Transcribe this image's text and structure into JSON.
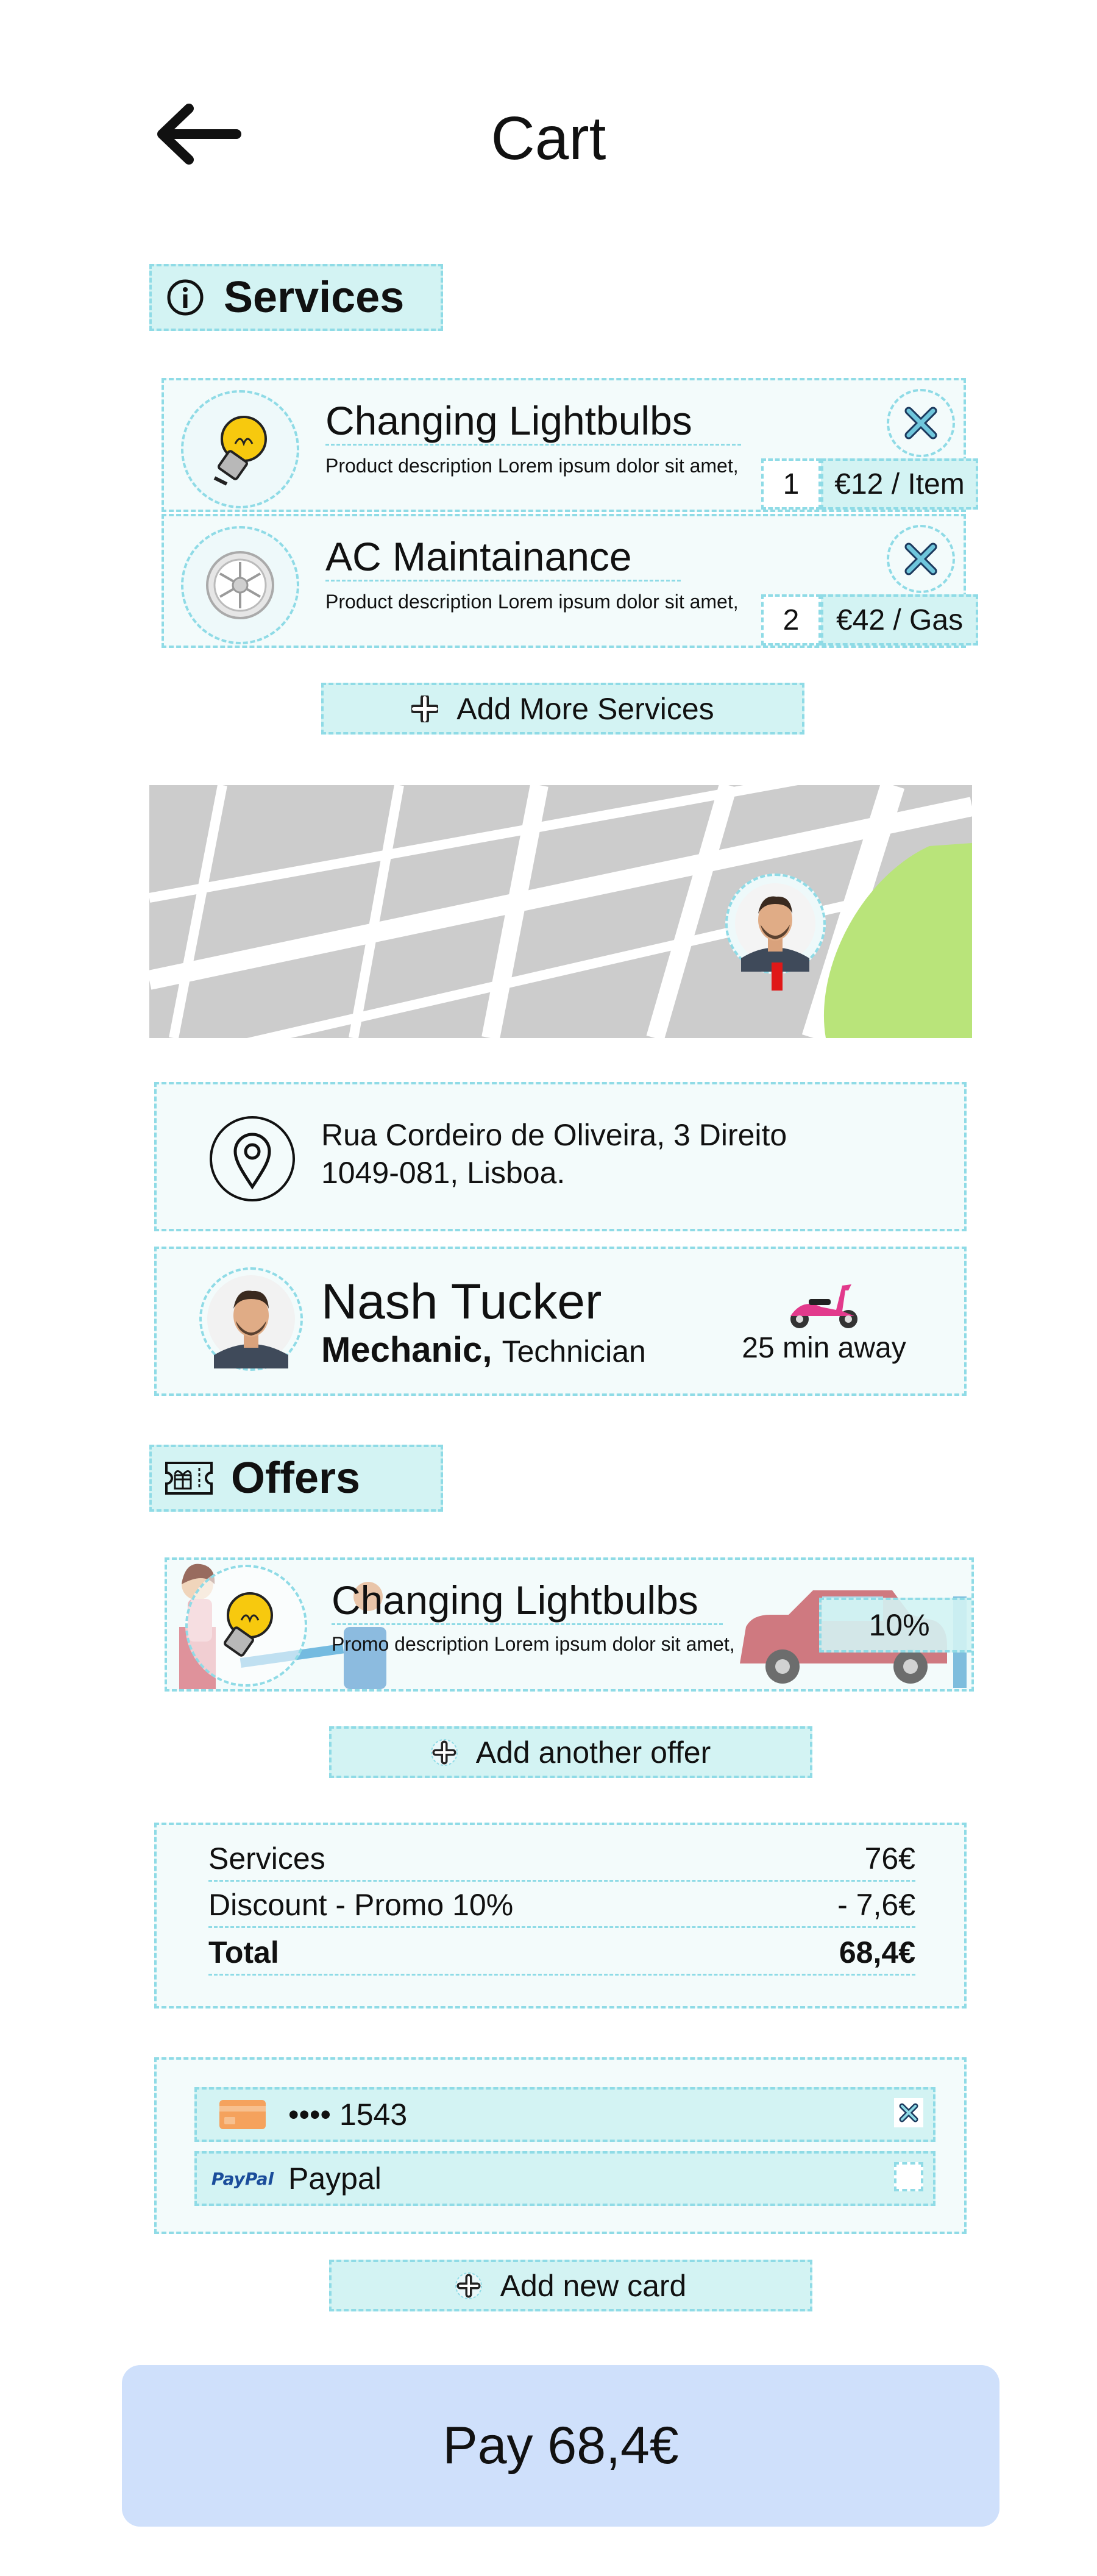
{
  "header": {
    "title": "Cart",
    "back_icon": "arrow-left-icon"
  },
  "services_section": {
    "title": "Services",
    "icon": "info-icon",
    "items": [
      {
        "name": "Changing Lightbulbs",
        "description": "Product description Lorem ipsum dolor sit amet,",
        "quantity": "1",
        "price": "€12 / Item",
        "icon": "lightbulb-icon"
      },
      {
        "name": "AC Maintainance",
        "description": "Product description Lorem ipsum dolor sit amet,",
        "quantity": "2",
        "price": "€42 / Gas",
        "icon": "ac-fan-icon"
      }
    ],
    "add_label": "Add More Services"
  },
  "address": {
    "line1": "Rua Cordeiro de Oliveira, 3 Direito",
    "line2": "1049-081, Lisboa.",
    "icon": "location-pin-icon"
  },
  "worker": {
    "name": "Nash Tucker",
    "role": "Mechanic,",
    "subrole": "Technician",
    "eta": "25 min away",
    "vehicle_icon": "scooter-icon"
  },
  "offers_section": {
    "title": "Offers",
    "icon": "gift-voucher-icon",
    "offer": {
      "name": "Changing Lightbulbs",
      "description": "Promo description Lorem ipsum dolor sit amet,",
      "discount": "10%"
    },
    "add_label": "Add another offer"
  },
  "summary": {
    "rows": [
      {
        "label": "Services",
        "value": "76€"
      },
      {
        "label": "Discount - Promo 10%",
        "value": "- 7,6€"
      }
    ],
    "total_label": "Total",
    "total_value": "68,4€"
  },
  "payments": {
    "methods": [
      {
        "label": "•••• 1543",
        "icon": "credit-card-icon",
        "selected": true
      },
      {
        "label": "Paypal",
        "icon": "paypal-logo",
        "logo_text": "PayPal",
        "selected": false
      }
    ],
    "add_label": "Add new card"
  },
  "pay_button": {
    "label": "Pay 68,4€"
  },
  "colors": {
    "accent_border": "#8fdbe6",
    "chip_bg": "#d3f3f3",
    "panel_bg": "#f3fbfb",
    "pay_bg": "#cfe0fb",
    "map_park": "#b9e47a"
  }
}
